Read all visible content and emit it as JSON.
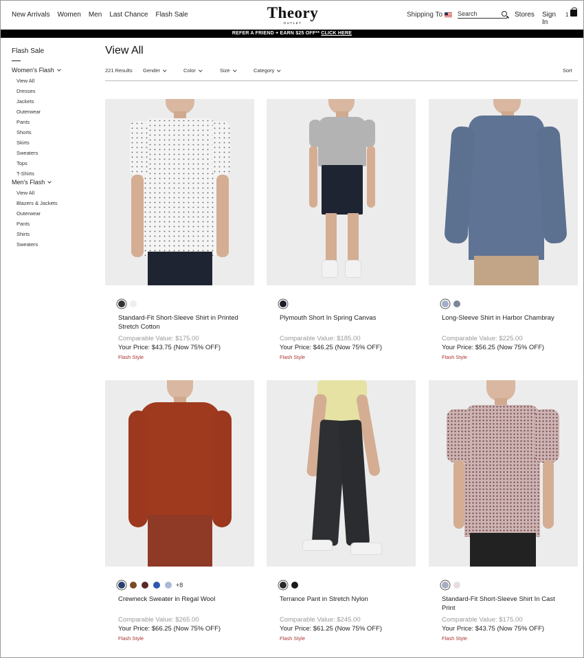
{
  "nav": {
    "links": [
      "New Arrivals",
      "Women",
      "Men",
      "Last Chance",
      "Flash Sale"
    ],
    "logo": "Theory",
    "logo_sub": "OUTLET",
    "shipping": "Shipping To",
    "search_placeholder": "Search",
    "stores": "Stores",
    "sign_in": "Sign In",
    "bag_count": "1"
  },
  "promo": {
    "text": "REFER A FRIEND + EARN $25 OFF** ",
    "link": "CLICK HERE"
  },
  "sidebar": {
    "title": "Flash Sale",
    "womens": {
      "label": "Women's Flash",
      "items": [
        "View All",
        "Dresses",
        "Jackets",
        "Outerwear",
        "Pants",
        "Shorts",
        "Skirts",
        "Sweaters",
        "Tops",
        "T-Shirts"
      ]
    },
    "mens": {
      "label": "Men's Flash",
      "items": [
        "View All",
        "Blazers & Jackets",
        "Outerwear",
        "Pants",
        "Shirts",
        "Sweaters"
      ]
    }
  },
  "main": {
    "title": "View All",
    "results": "221 Results",
    "filters": [
      "Gender",
      "Color",
      "Size",
      "Category"
    ],
    "sort": "Sort"
  },
  "products": [
    {
      "name": "Standard-Fit Short-Sleeve Shirt in Printed Stretch Cotton",
      "comparable": "Comparable Value: $175.00",
      "price": "Your Price: $43.75 (Now 75% OFF)",
      "flash": "Flash Style",
      "swatches": [
        "#333333",
        "#eeeeee"
      ],
      "more": ""
    },
    {
      "name": "Plymouth Short In Spring Canvas",
      "comparable": "Comparable Value: $185.00",
      "price": "Your Price: $46.25 (Now 75% OFF)",
      "flash": "Flash Style",
      "swatches": [
        "#1c1f2a"
      ],
      "more": ""
    },
    {
      "name": "Long-Sleeve Shirt in Harbor Chambray",
      "comparable": "Comparable Value: $225.00",
      "price": "Your Price: $56.25 (Now 75% OFF)",
      "flash": "Flash Style",
      "swatches": [
        "#9fb0c8",
        "#7a879e"
      ],
      "more": ""
    },
    {
      "name": "Crewneck Sweater in Regal Wool",
      "comparable": "Comparable Value: $265.00",
      "price": "Your Price: $66.25 (Now 75% OFF)",
      "flash": "Flash Style",
      "swatches": [
        "#2a3f6e",
        "#7a4a22",
        "#5a2828",
        "#2f56b0",
        "#a9b8d6"
      ],
      "more": "+8"
    },
    {
      "name": "Terrance Pant in Stretch Nylon",
      "comparable": "Comparable Value: $245.00",
      "price": "Your Price: $61.25 (Now 75% OFF)",
      "flash": "Flash Style",
      "swatches": [
        "#2a2a2a",
        "#1a1a1a"
      ],
      "more": ""
    },
    {
      "name": "Standard-Fit Short-Sleeve Shirt In Cast Print",
      "comparable": "Comparable Value: $175.00",
      "price": "Your Price: $43.75 (Now 75% OFF)",
      "flash": "Flash Style",
      "swatches": [
        "#a8acc0",
        "#e6dede"
      ],
      "more": ""
    }
  ]
}
